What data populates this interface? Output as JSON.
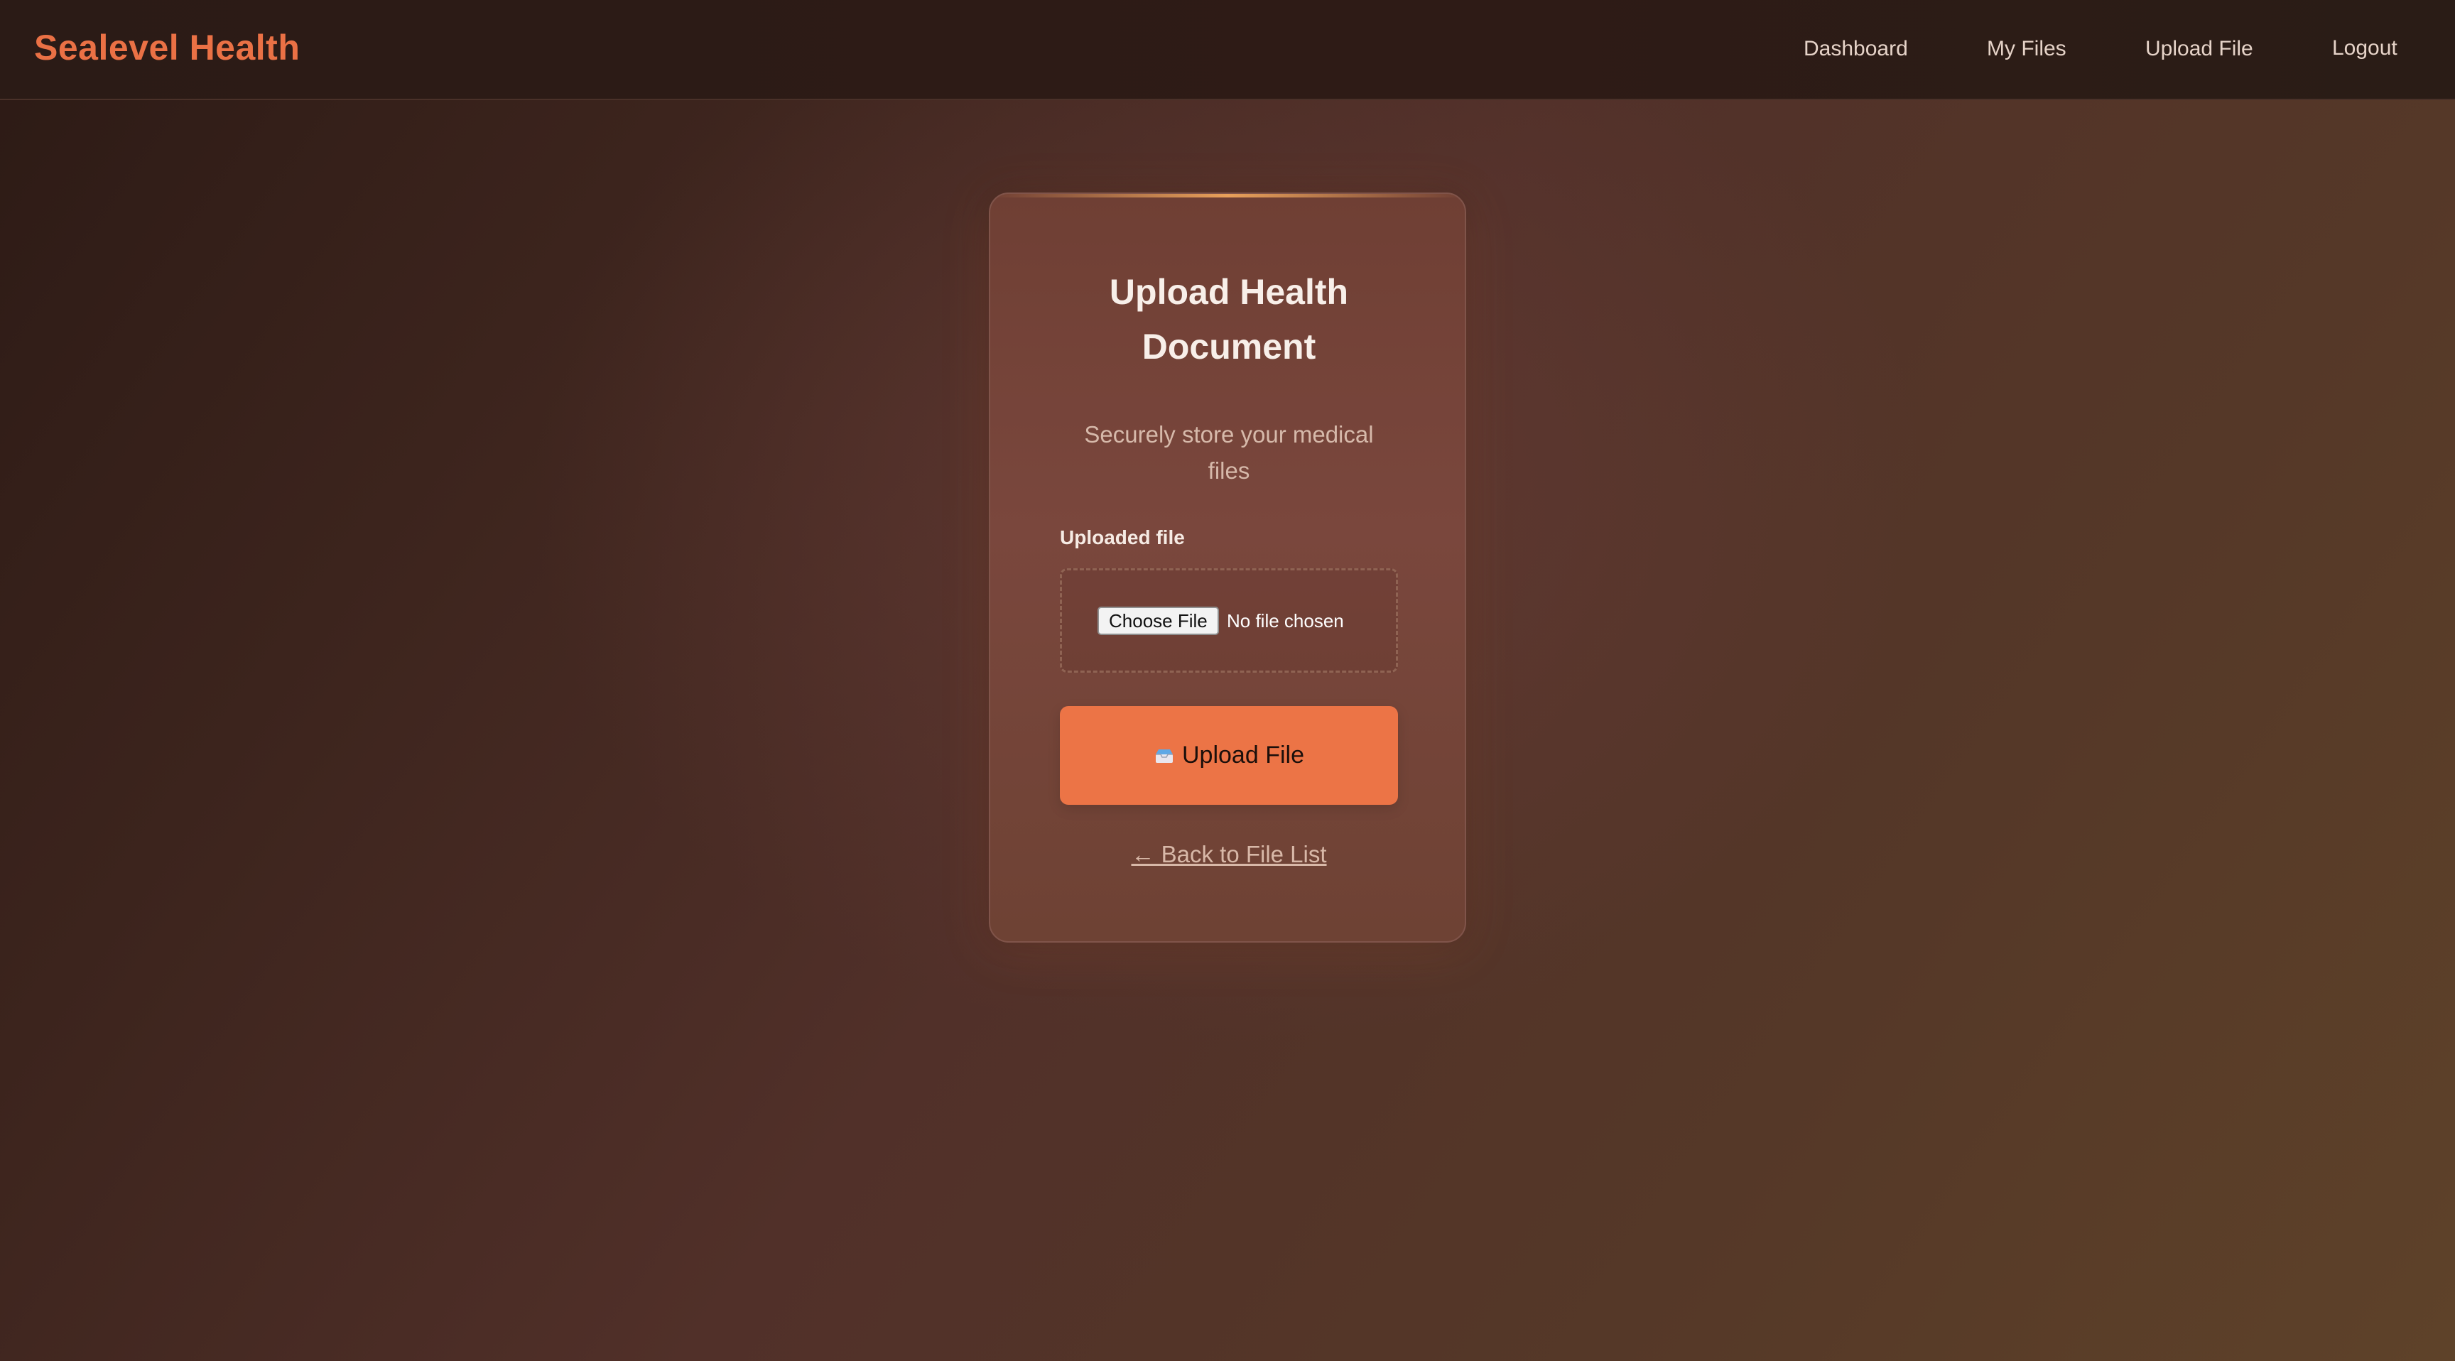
{
  "header": {
    "brand": "Sealevel Health",
    "nav": [
      {
        "label": "Dashboard"
      },
      {
        "label": "My Files"
      },
      {
        "label": "Upload File"
      },
      {
        "label": "Logout"
      }
    ]
  },
  "card": {
    "title": "Upload Health Document",
    "subtitle": "Securely store your medical files",
    "field_label": "Uploaded file",
    "file_input": {
      "button_label": "Choose File",
      "status": "No file chosen"
    },
    "submit": {
      "icon": "inbox-tray-icon",
      "label": "Upload File"
    },
    "back_link": "← Back to File List"
  },
  "colors": {
    "brand": "#ea7145",
    "button": "#ec7446",
    "accent_line": "#e8a05a"
  }
}
